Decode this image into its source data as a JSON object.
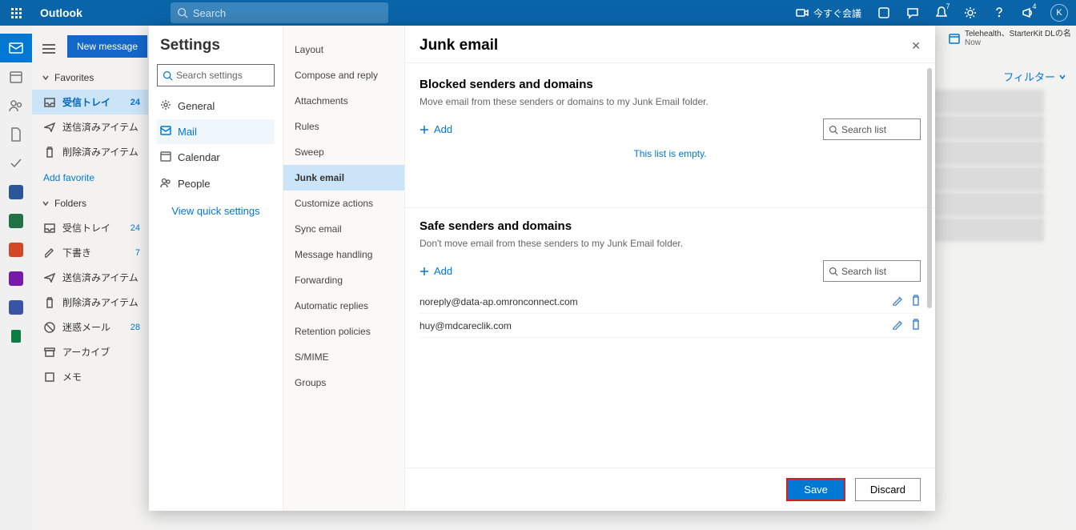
{
  "header": {
    "brand": "Outlook",
    "search_placeholder": "Search",
    "meet_now": "今すぐ会議",
    "notification_badge": "7",
    "share_badge": "4",
    "avatar_initial": "K"
  },
  "right_strip": {
    "line1": "Telehealth、StarterKit DLの名",
    "line2": "Now"
  },
  "filter_label": "フィルター",
  "nav": {
    "new_message": "New message",
    "favorites_header": "Favorites",
    "folders_header": "Folders",
    "add_favorite": "Add favorite",
    "favorites": [
      {
        "label": "受信トレイ",
        "count": "24",
        "icon": "inbox",
        "selected": true
      },
      {
        "label": "送信済みアイテム",
        "icon": "sent"
      },
      {
        "label": "削除済みアイテム",
        "icon": "trash"
      }
    ],
    "folders": [
      {
        "label": "受信トレイ",
        "count": "24",
        "icon": "inbox"
      },
      {
        "label": "下書き",
        "count": "7",
        "icon": "draft"
      },
      {
        "label": "送信済みアイテム",
        "icon": "sent"
      },
      {
        "label": "削除済みアイテム",
        "icon": "trash"
      },
      {
        "label": "迷惑メール",
        "count": "28",
        "icon": "spam"
      },
      {
        "label": "アーカイブ",
        "icon": "archive"
      },
      {
        "label": "メモ",
        "icon": "note"
      }
    ]
  },
  "settings": {
    "title": "Settings",
    "search_placeholder": "Search settings",
    "categories": [
      {
        "label": "General",
        "icon": "gear"
      },
      {
        "label": "Mail",
        "icon": "mail",
        "active": true
      },
      {
        "label": "Calendar",
        "icon": "calendar"
      },
      {
        "label": "People",
        "icon": "people"
      }
    ],
    "quick_link": "View quick settings",
    "sub_items": [
      "Layout",
      "Compose and reply",
      "Attachments",
      "Rules",
      "Sweep",
      "Junk email",
      "Customize actions",
      "Sync email",
      "Message handling",
      "Forwarding",
      "Automatic replies",
      "Retention policies",
      "S/MIME",
      "Groups"
    ],
    "active_sub": "Junk email"
  },
  "junk": {
    "title": "Junk email",
    "blocked_heading": "Blocked senders and domains",
    "blocked_desc": "Move email from these senders or domains to my Junk Email folder.",
    "add_label": "Add",
    "search_placeholder": "Search list",
    "blocked_empty": "This list is empty.",
    "safe_heading": "Safe senders and domains",
    "safe_desc": "Don't move email from these senders to my Junk Email folder.",
    "safe_list": [
      "noreply@data-ap.omronconnect.com",
      "huy@mdcareclik.com"
    ],
    "save": "Save",
    "discard": "Discard"
  }
}
